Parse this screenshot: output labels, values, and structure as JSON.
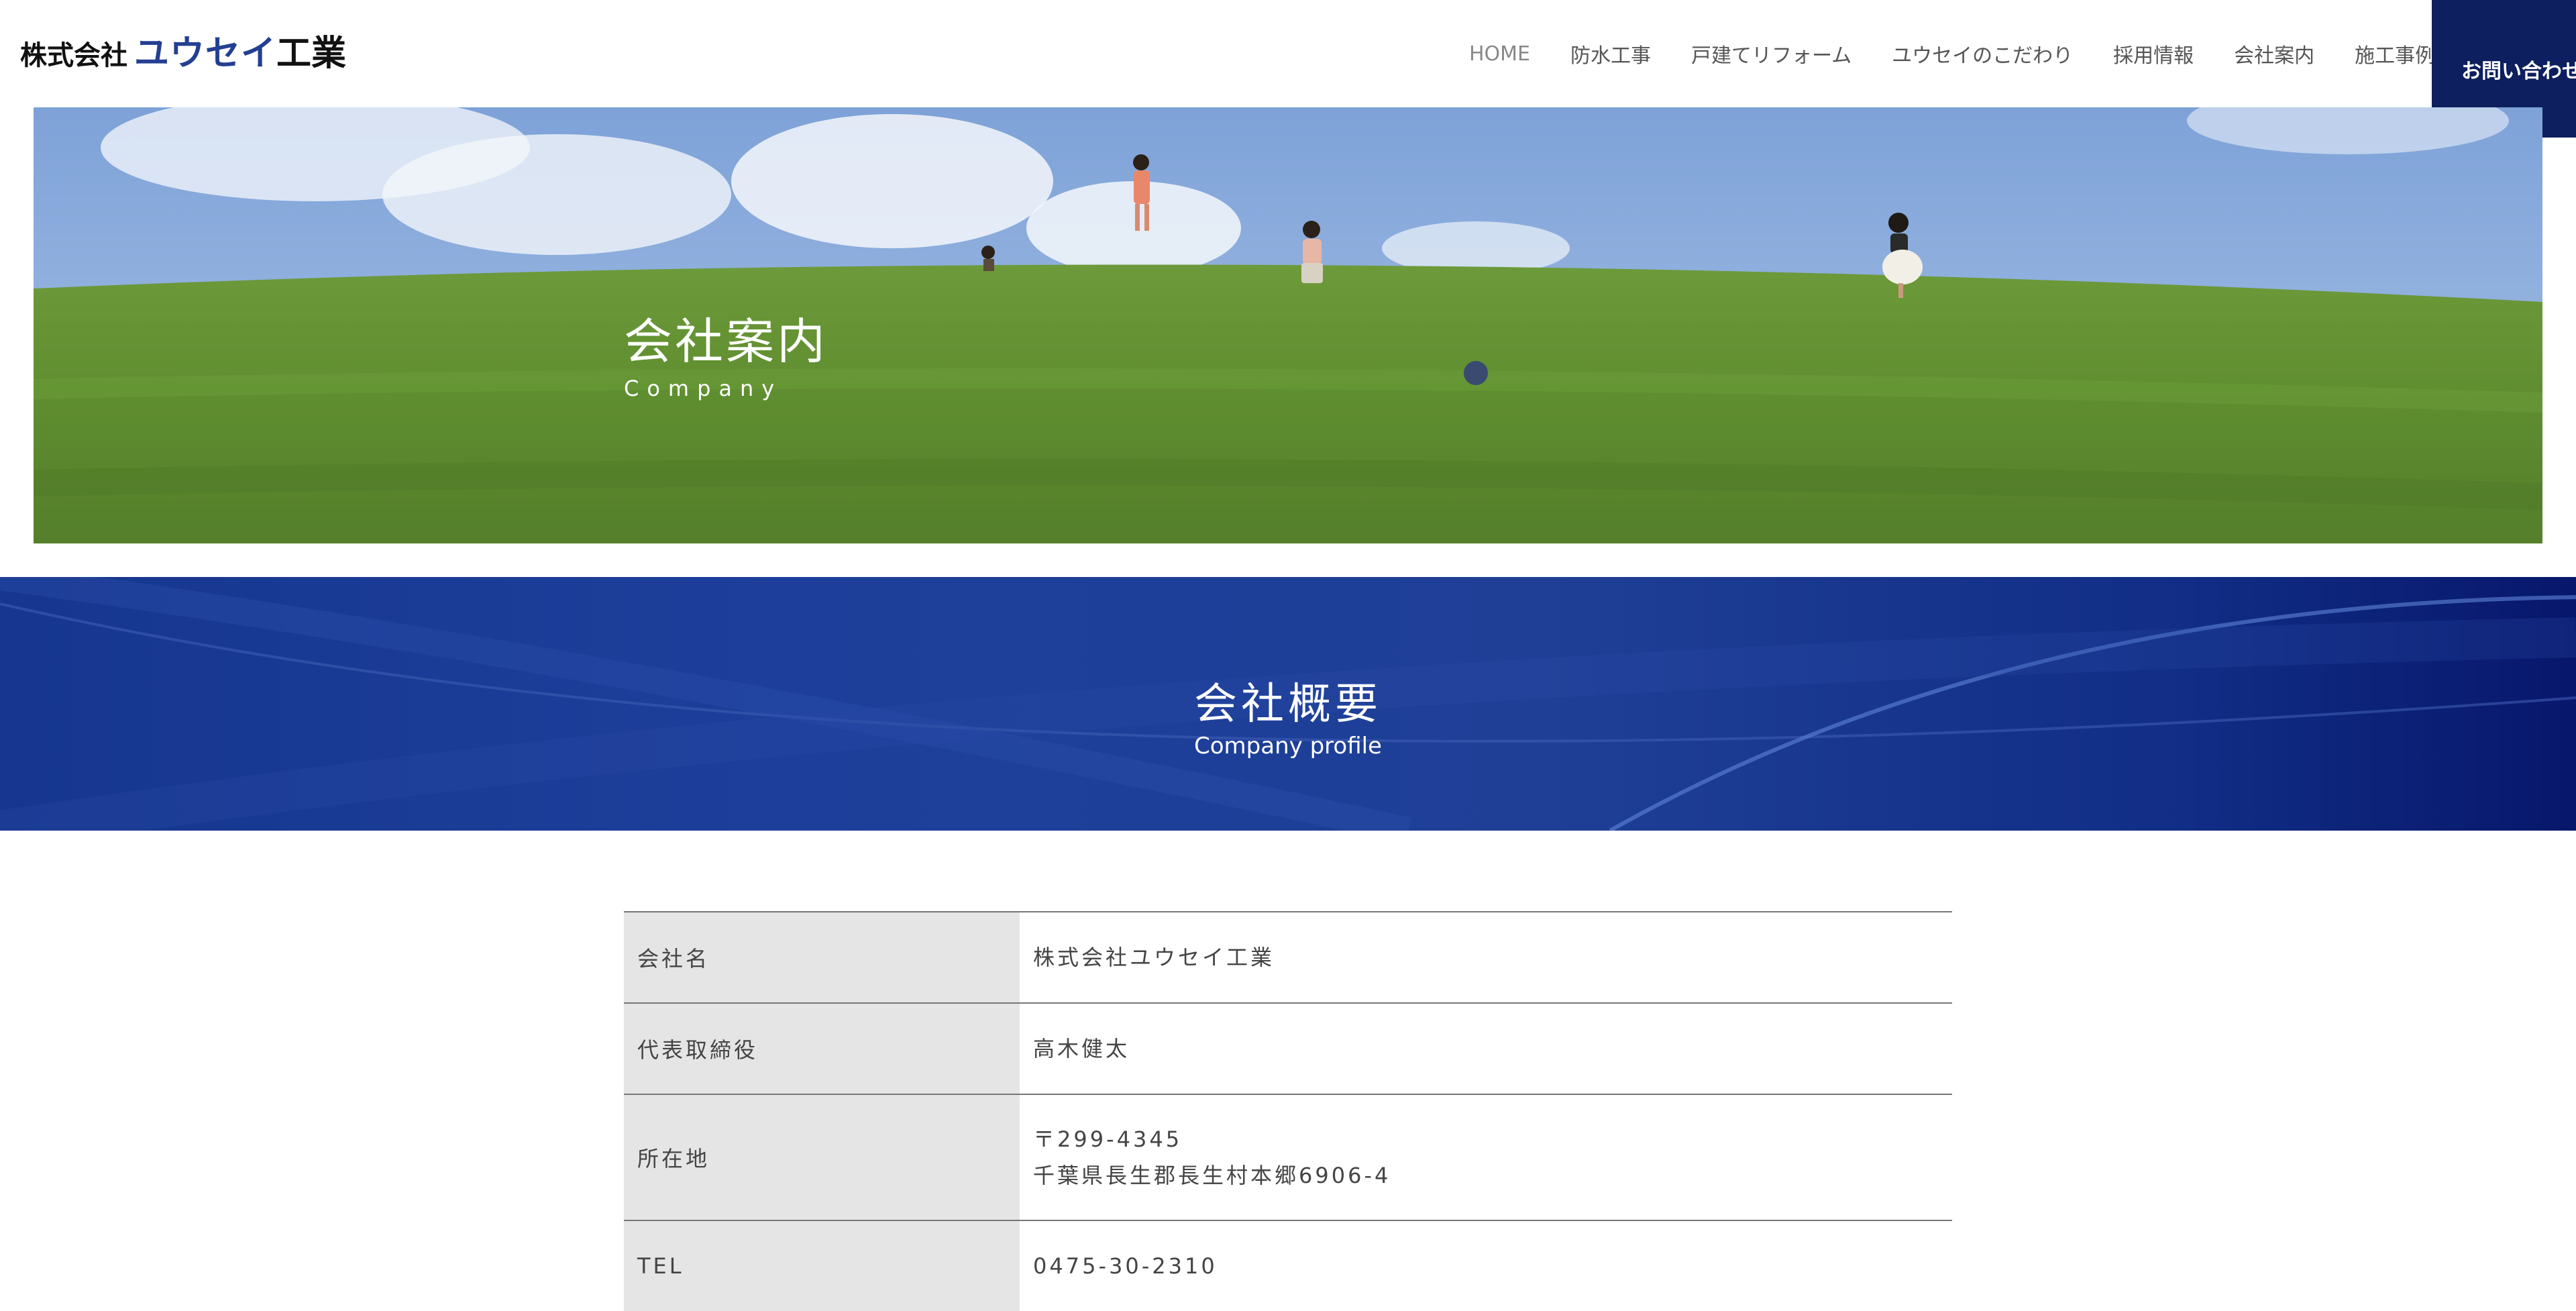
{
  "header": {
    "logo": {
      "prefix": "株式会社",
      "name": "ユウセイ",
      "suffix": "工業"
    },
    "nav": [
      "HOME",
      "防水工事",
      "戸建てリフォーム",
      "ユウセイのこだわり",
      "採用情報",
      "会社案内",
      "施工事例"
    ],
    "contact_label": "お問い合わせ"
  },
  "hero": {
    "title": "会社案内",
    "subtitle": "Company"
  },
  "section": {
    "title": "会社概要",
    "subtitle": "Company profile"
  },
  "profile": {
    "rows": [
      {
        "label": "会社名",
        "lines": [
          "株式会社ユウセイ工業"
        ]
      },
      {
        "label": "代表取締役",
        "lines": [
          "高木健太"
        ]
      },
      {
        "label": "所在地",
        "lines": [
          "〒299-4345",
          "千葉県長生郡長生村本郷6906-4"
        ]
      },
      {
        "label": "TEL",
        "lines": [
          "0475-30-2310"
        ]
      }
    ]
  },
  "colors": {
    "brand_navy": "#0d1f5e",
    "logo_blue": "#233f91",
    "banner_blue": "#1d3f9b",
    "table_label_bg": "#e5e5e5"
  }
}
